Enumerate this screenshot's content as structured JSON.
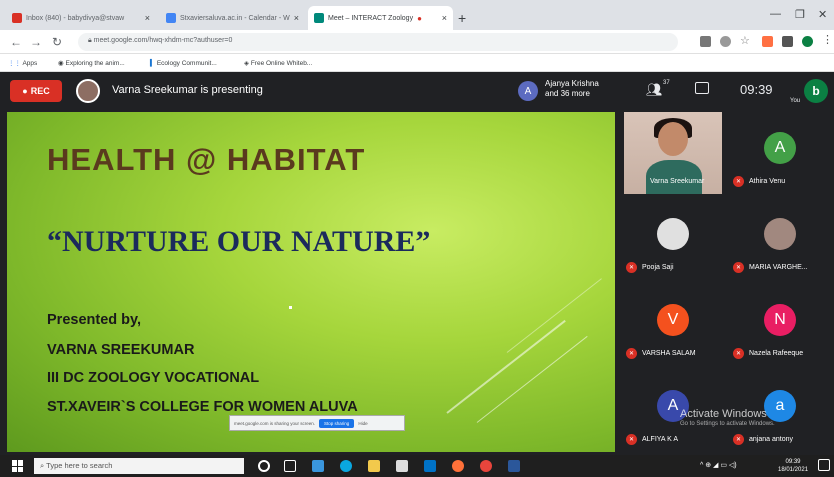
{
  "browser": {
    "tabs": [
      {
        "label": "Inbox (840) - babydivya@stvaw",
        "icon_color": "#d93025"
      },
      {
        "label": "Stxaviersaluva.ac.in - Calendar - W",
        "icon_color": "#4285f4"
      },
      {
        "label": "Meet – INTERACT Zoology",
        "icon_color": "#00897b"
      }
    ],
    "new_tab": "+",
    "url": "meet.google.com/hwq-xhdm-mc?authuser=0",
    "bookmarks": [
      "Apps",
      "Exploring the anim...",
      "Ecology Communit...",
      "Free Online Whiteb..."
    ]
  },
  "meet": {
    "rec_label": "REC",
    "presenting_text": "Varna Sreekumar is presenting",
    "join_initial": "A",
    "join_text_line1": "Ajanya Krishna",
    "join_text_line2": "and 36 more",
    "people_count": "37",
    "clock": "09:39",
    "you_initial": "b",
    "you_label": "You"
  },
  "slide": {
    "title": "HEALTH @ HABITAT",
    "subtitle": "“NURTURE OUR NATURE”",
    "lines": [
      "Presented by,",
      "VARNA SREEKUMAR",
      "III DC ZOOLOGY VOCATIONAL",
      "ST.XAVEIR`S COLLEGE FOR WOMEN ALUVA"
    ],
    "share_text": "meet.google.com is sharing your screen.",
    "stop_label": "Stop sharing",
    "hide_label": "Hide"
  },
  "participants": [
    {
      "name": "Varna Sreekumar",
      "initial": "",
      "color": "#8d6e63"
    },
    {
      "name": "Athira Venu",
      "initial": "A",
      "color": "#43a047"
    },
    {
      "name": "Pooja Saji",
      "initial": "",
      "color": "#bdbdbd"
    },
    {
      "name": "MARIA VARGHE...",
      "initial": "",
      "color": "#a1887f"
    },
    {
      "name": "VARSHA SALAM",
      "initial": "V",
      "color": "#f4511e"
    },
    {
      "name": "Nazela Rafeeque",
      "initial": "N",
      "color": "#e91e63"
    },
    {
      "name": "ALFIYA K A",
      "initial": "A",
      "color": "#3949ab"
    },
    {
      "name": "anjana antony",
      "initial": "a",
      "color": "#1e88e5"
    }
  ],
  "watermark": {
    "line1": "Activate Windows",
    "line2": "Go to Settings to activate Windows."
  },
  "taskbar": {
    "search_placeholder": "Type here to search",
    "time": "09:39",
    "date": "18/01/2021"
  }
}
